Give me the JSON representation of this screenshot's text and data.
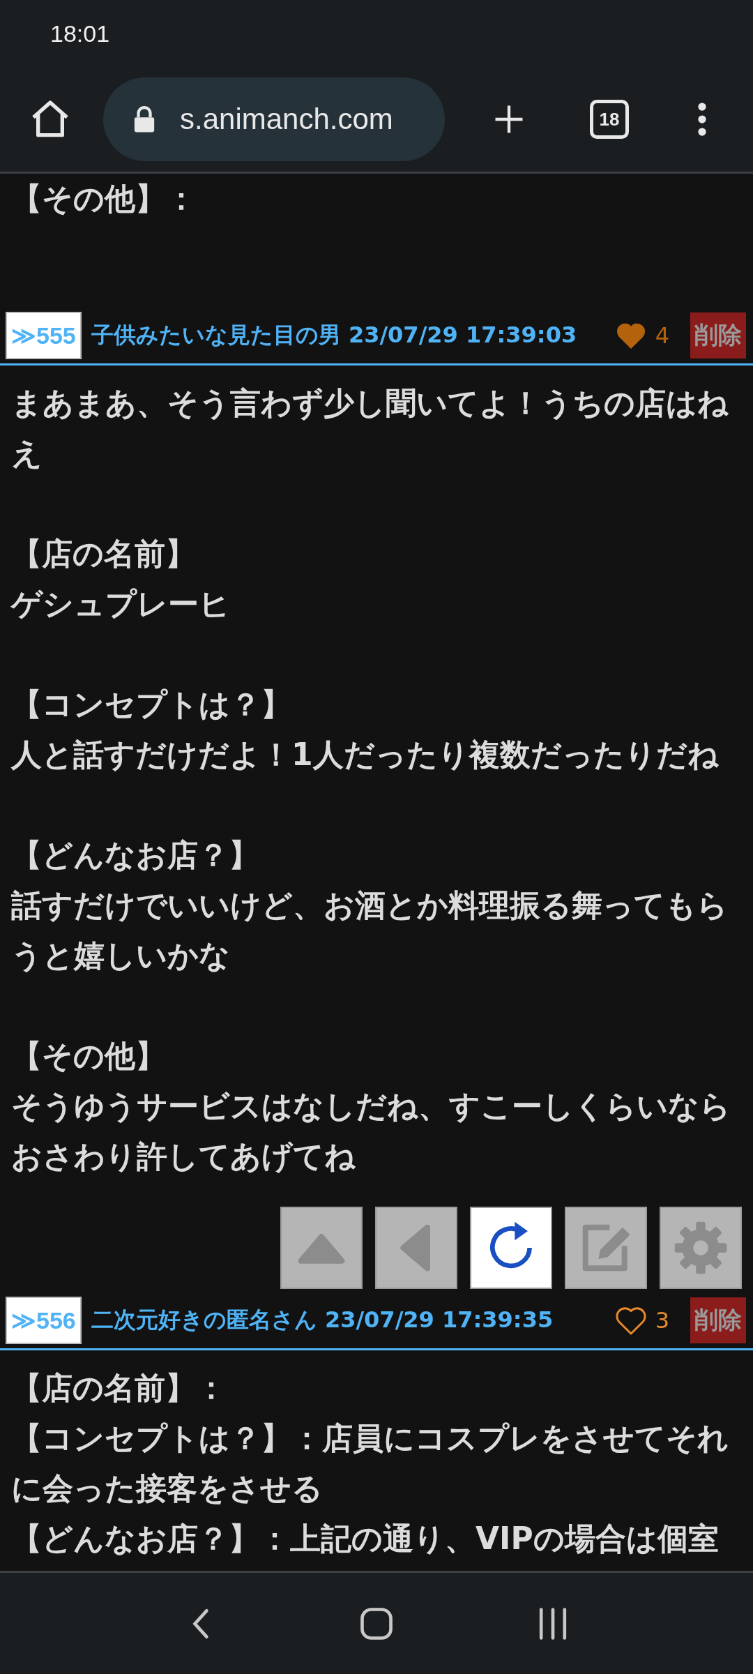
{
  "status_bar": {
    "time": "18:01"
  },
  "browser": {
    "url": "s.animanch.com",
    "tab_count": "18"
  },
  "top_text": "【その他】：",
  "posts": [
    {
      "number": "≫555",
      "name": "子供みたいな見た目の男",
      "date": "23/07/29 17:39:03",
      "liked": true,
      "likes": "4",
      "delete_label": "削除",
      "paragraphs": [
        [
          "まあまあ、そう言わず少し聞いてよ！うちの店はねえ"
        ],
        [
          "【店の名前】",
          "ゲシュプレーヒ"
        ],
        [
          "【コンセプトは？】",
          "人と話すだけだよ！1人だったり複数だったりだね"
        ],
        [
          "【どんなお店？】",
          "話すだけでいいけど、お酒とか料理振る舞ってもらうと嬉しいかな"
        ],
        [
          "【その他】",
          "そうゆうサービスはなしだね、すこーしくらいならおさわり許してあげてね"
        ]
      ]
    },
    {
      "number": "≫556",
      "name": "二次元好きの匿名さん",
      "date": "23/07/29 17:39:35",
      "liked": false,
      "likes": "3",
      "delete_label": "削除",
      "paragraphs": [
        [
          "【店の名前】：",
          "【コンセプトは？】：店員にコスプレをさせてそれに会った接客をさせる",
          "【どんなお店？】：上記の通り、VIPの場合は個室"
        ]
      ]
    }
  ],
  "toolbar": [
    {
      "kind": "up",
      "active": false
    },
    {
      "kind": "back",
      "active": false
    },
    {
      "kind": "reload",
      "active": true
    },
    {
      "kind": "edit",
      "active": false
    },
    {
      "kind": "settings",
      "active": false
    }
  ]
}
